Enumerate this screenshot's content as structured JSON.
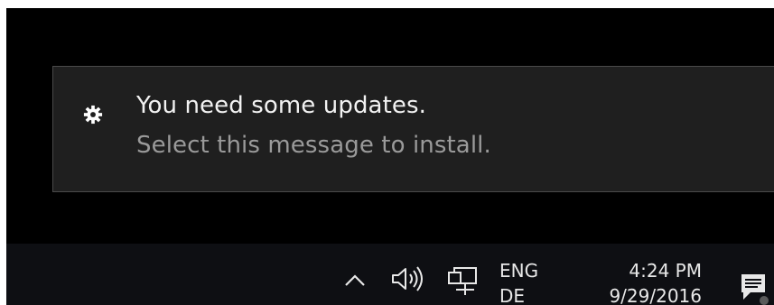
{
  "notification": {
    "icon": "gear-icon",
    "title": "You need some updates.",
    "message": "Select this message to install."
  },
  "taskbar": {
    "tray_icons": [
      "chevron-up-icon",
      "speaker-icon",
      "network-icon"
    ],
    "language": {
      "line1": "ENG",
      "line2": "DE"
    },
    "clock": {
      "time": "4:24 PM",
      "date": "9/29/2016"
    },
    "action_center_icon": "action-center-icon"
  },
  "colors": {
    "background": "#000000",
    "toast_background": "#1f1f1f",
    "toast_border": "#4a4a4a",
    "title_text": "#f2f2f2",
    "secondary_text": "#9a9a9a",
    "taskbar": "#0e0f13"
  }
}
